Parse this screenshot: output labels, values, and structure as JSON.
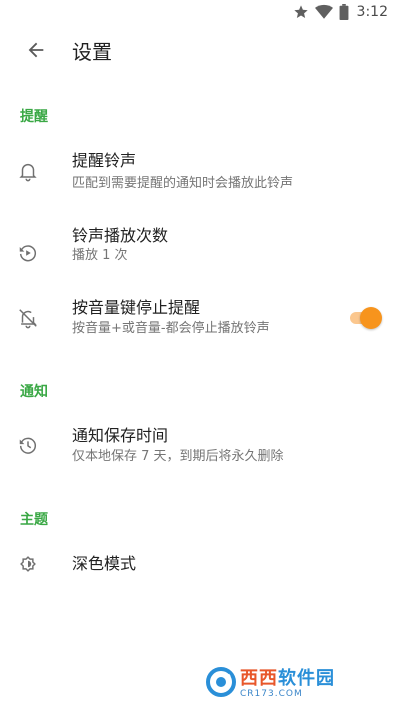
{
  "status_bar": {
    "time": "3:12",
    "icons": [
      "star-icon",
      "wifi-icon",
      "battery-icon"
    ]
  },
  "app_bar": {
    "title": "设置",
    "back_icon": "arrow-back-icon"
  },
  "sections": {
    "reminder": {
      "header": "提醒",
      "items": [
        {
          "title": "提醒铃声",
          "subtitle": "匹配到需要提醒的通知时会播放此铃声",
          "icon": "bell-icon"
        },
        {
          "title": "铃声播放次数",
          "subtitle": "播放 1 次",
          "icon": "replay-icon"
        },
        {
          "title": "按音量键停止提醒",
          "subtitle": "按音量+或音量-都会停止播放铃声",
          "icon": "bell-off-icon",
          "toggle_on": true
        }
      ]
    },
    "notification": {
      "header": "通知",
      "items": [
        {
          "title": "通知保存时间",
          "subtitle": "仅本地保存 7 天，到期后将永久删除",
          "icon": "history-icon"
        }
      ]
    },
    "theme": {
      "header": "主题",
      "items": [
        {
          "title": "深色模式",
          "icon": "theme-gear-icon"
        }
      ]
    }
  },
  "watermark": {
    "brand_highlight": "西西",
    "brand_rest": "软件园",
    "url": "CR173.COM"
  },
  "colors": {
    "accent_green": "#3aa845",
    "toggle_thumb": "#f7941d",
    "toggle_track": "#fbc78e",
    "primary_text": "#212121",
    "secondary_text": "#757575"
  }
}
